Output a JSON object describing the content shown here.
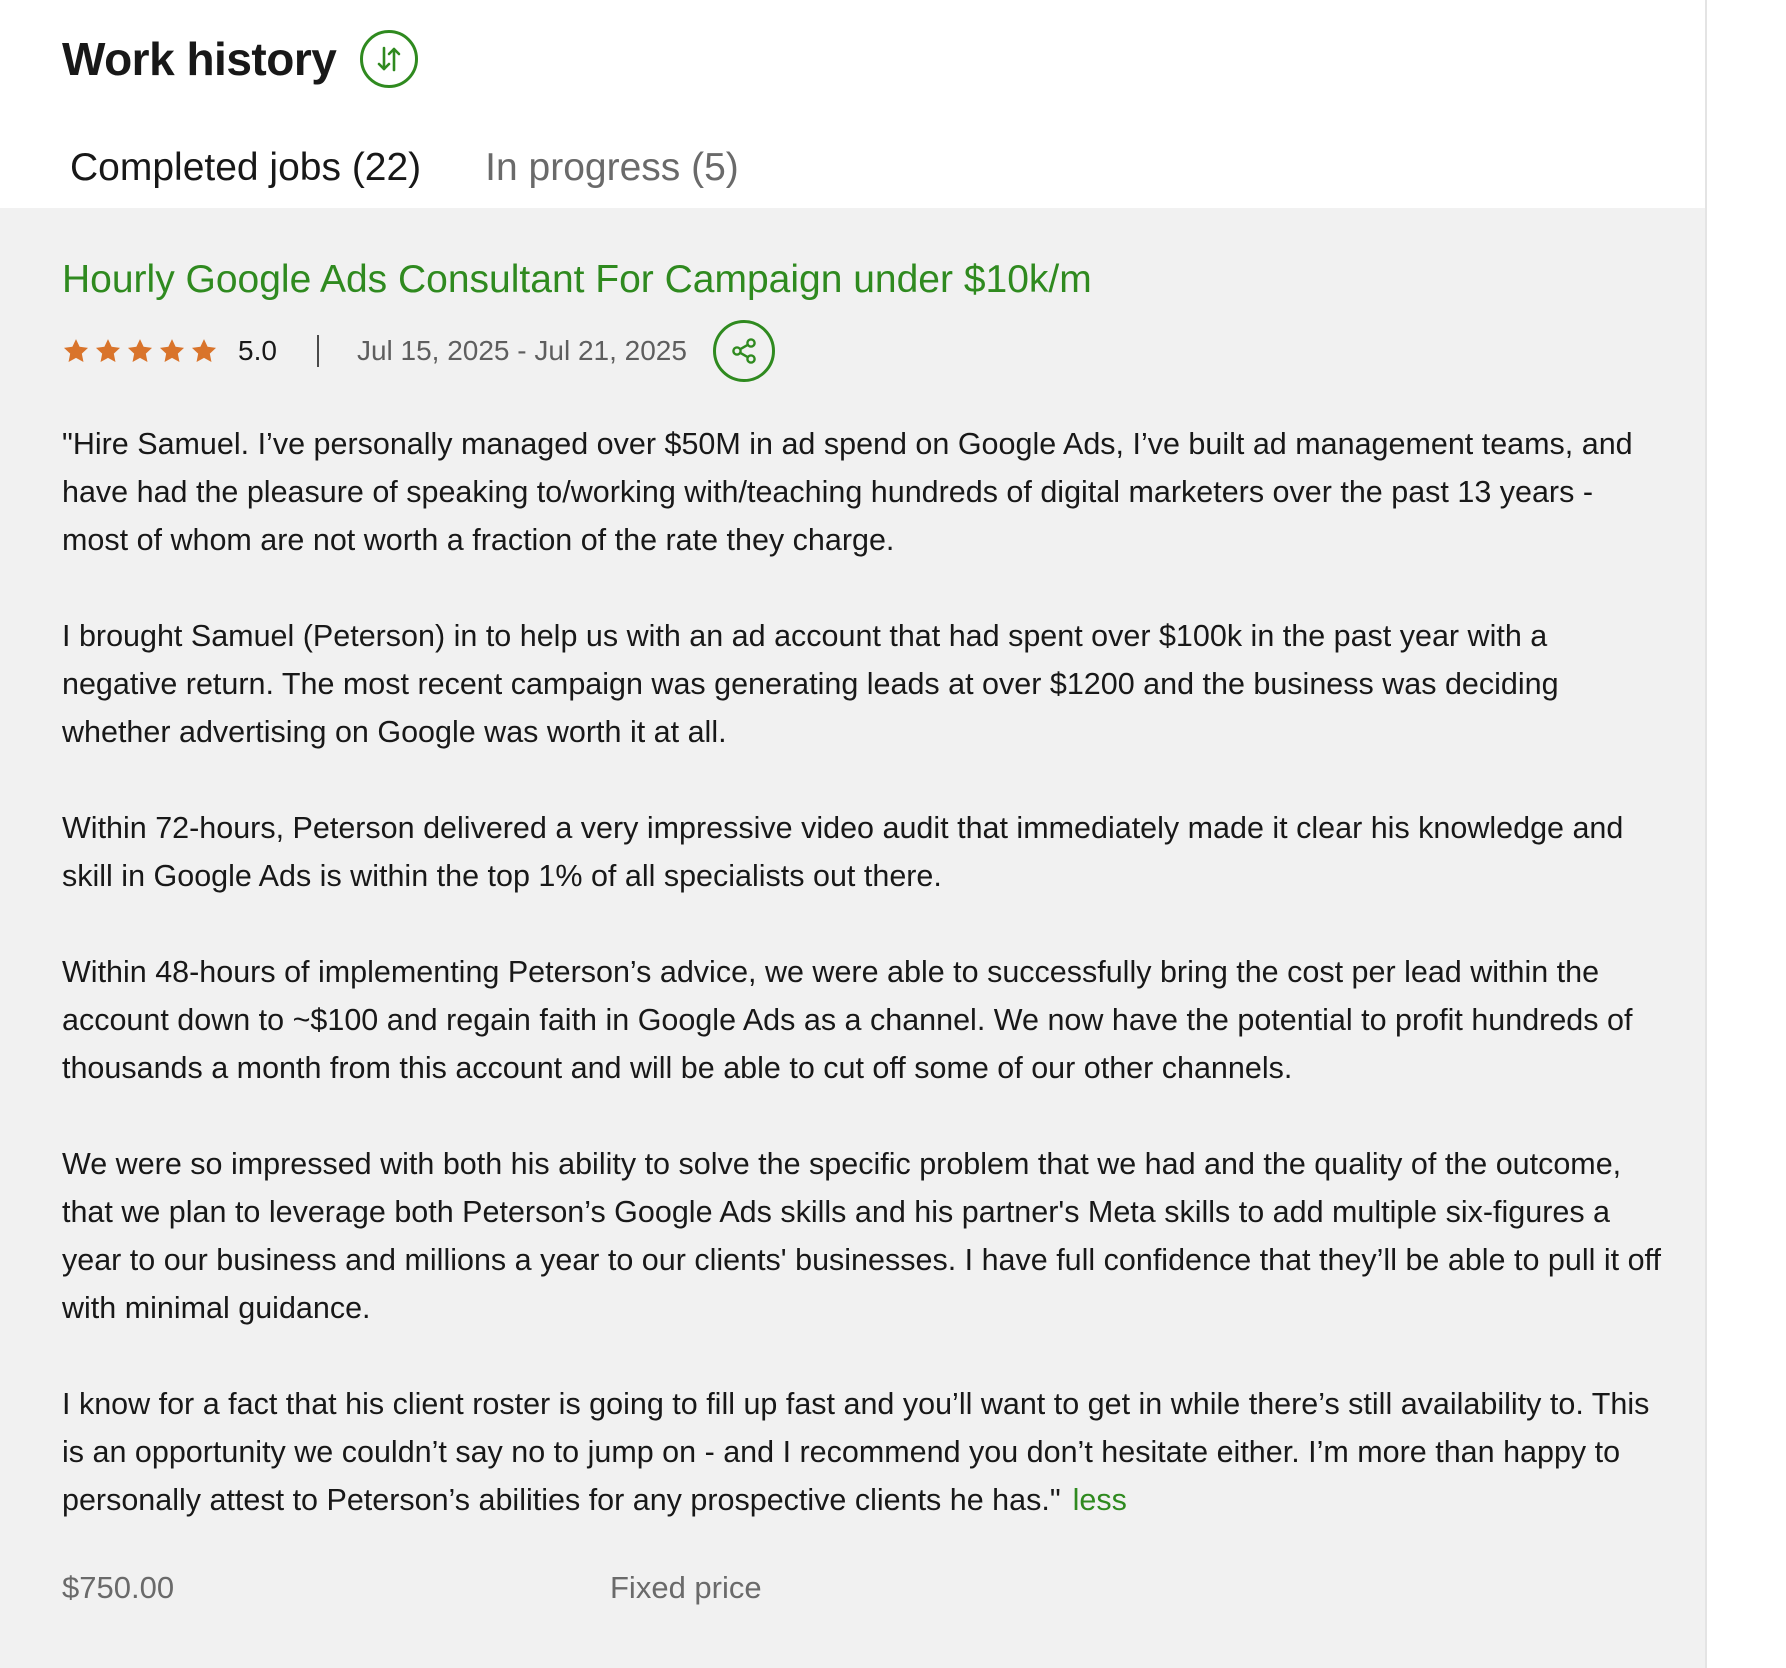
{
  "header": {
    "title": "Work history",
    "sort_icon": "sort-arrows-icon"
  },
  "tabs": [
    {
      "label": "Completed jobs (22)",
      "active": true
    },
    {
      "label": "In progress (5)",
      "active": false
    }
  ],
  "job": {
    "title": "Hourly Google Ads Consultant For Campaign under $10k/m",
    "rating": "5.0",
    "stars": 5,
    "dates": "Jul 15, 2025 - Jul 21, 2025",
    "share_icon": "share-icon",
    "review_paragraphs": [
      "\"Hire Samuel. I’ve personally managed over $50M in ad spend on Google Ads, I’ve built ad management teams, and have had the pleasure of speaking to/working with/teaching hundreds of digital marketers over the past 13 years - most of whom are not worth a fraction of the rate they charge.",
      "I brought Samuel (Peterson) in to help us with an ad account that had spent over $100k in the past year with a negative return. The most recent campaign was generating leads at over $1200 and the business was deciding whether advertising on Google was worth it at all.",
      "Within 72-hours, Peterson delivered a very impressive video audit that immediately made it clear his knowledge and skill in Google Ads is within the top 1% of all specialists out there.",
      "Within 48-hours of implementing Peterson’s advice, we were able to successfully bring the cost per lead within the account down to ~$100 and regain faith in Google Ads as a channel. We now have the potential to profit hundreds of thousands a month from this account and will be able to cut off some of our other channels.",
      "We were so impressed with both his ability to solve the specific problem that we had and the quality of the outcome, that we plan to leverage both Peterson’s Google Ads skills and his partner's Meta skills to add multiple six-figures a year to our business and millions a year to our clients' businesses. I have full confidence that they’ll be able to pull it off with minimal guidance.",
      "I know for a fact that his client roster is going to fill up fast and you’ll want to get in while there’s still availability to. This is an opportunity we couldn’t say no to jump on - and I recommend you don’t hesitate either. I’m more than happy to personally attest to Peterson’s abilities for any prospective clients he has.\""
    ],
    "less_label": "less",
    "price": "$750.00",
    "price_type": "Fixed price"
  },
  "colors": {
    "accent_green": "#2f8a1f",
    "star_orange": "#d9742b",
    "job_background": "#f1f1f1"
  }
}
